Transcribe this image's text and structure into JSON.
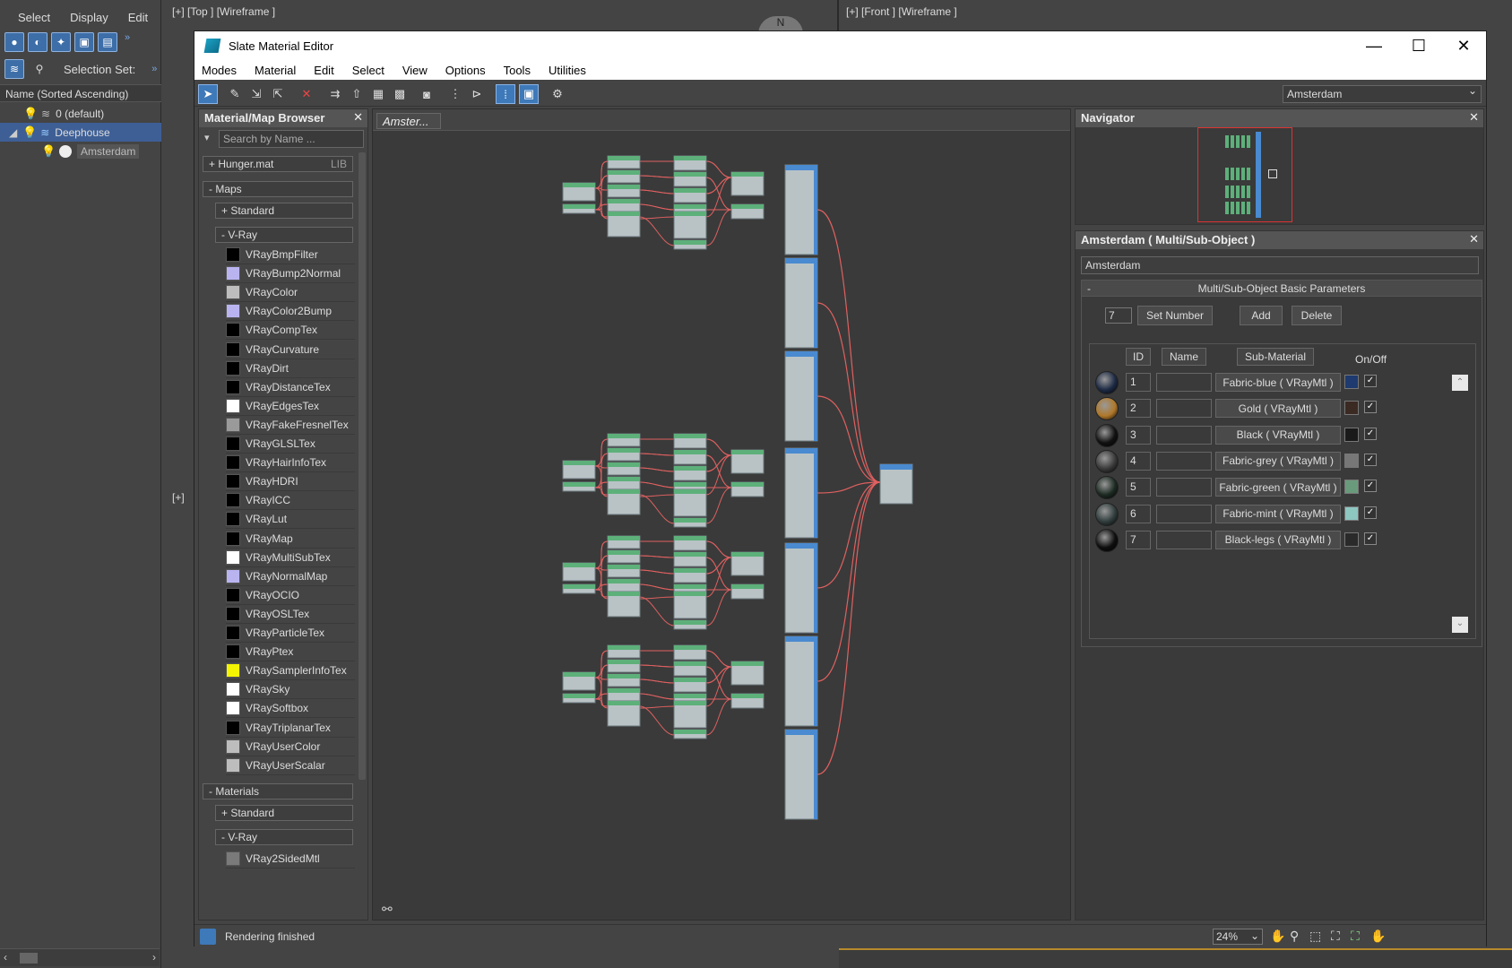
{
  "left_menu": [
    "Select",
    "Display",
    "Edit"
  ],
  "selection_set_label": "Selection Set:",
  "sort_header": "Name (Sorted Ascending)",
  "scene_tree": [
    {
      "label": "0 (default)",
      "selected": false
    },
    {
      "label": "Deephouse",
      "selected": true
    },
    {
      "label": "Amsterdam",
      "selected": false
    }
  ],
  "viewports": {
    "top_label": "[+] [Top ] [Wireframe ]",
    "front_label": "[+] [Front ] [Wireframe ]",
    "bottom_left_label": "[+]",
    "compass_letter": "N"
  },
  "editor": {
    "title": "Slate Material Editor",
    "menu": [
      "Modes",
      "Material",
      "Edit",
      "Select",
      "View",
      "Options",
      "Tools",
      "Utilities"
    ],
    "view_selector": "Amsterdam"
  },
  "browser": {
    "title": "Material/Map Browser",
    "search_placeholder": "Search by Name ...",
    "library": "+ Hunger.mat",
    "library_tag": "LIB",
    "maps_group": "- Maps",
    "standard_group": "+ Standard",
    "vray_group": "- V-Ray",
    "maps": [
      {
        "name": "VRayBmpFilter",
        "color": "#000000"
      },
      {
        "name": "VRayBump2Normal",
        "color": "#b9b4f0"
      },
      {
        "name": "VRayColor",
        "color": "#bdbdbd"
      },
      {
        "name": "VRayColor2Bump",
        "color": "#b9b4f0"
      },
      {
        "name": "VRayCompTex",
        "color": "#000000"
      },
      {
        "name": "VRayCurvature",
        "color": "#000000"
      },
      {
        "name": "VRayDirt",
        "color": "#000000"
      },
      {
        "name": "VRayDistanceTex",
        "color": "#000000"
      },
      {
        "name": "VRayEdgesTex",
        "color": "#ffffff"
      },
      {
        "name": "VRayFakeFresnelTex",
        "color": "#9a9a9a"
      },
      {
        "name": "VRayGLSLTex",
        "color": "#000000"
      },
      {
        "name": "VRayHairInfoTex",
        "color": "#000000"
      },
      {
        "name": "VRayHDRI",
        "color": "#000000"
      },
      {
        "name": "VRayICC",
        "color": "#000000"
      },
      {
        "name": "VRayLut",
        "color": "#000000"
      },
      {
        "name": "VRayMap",
        "color": "#000000"
      },
      {
        "name": "VRayMultiSubTex",
        "color": "#ffffff"
      },
      {
        "name": "VRayNormalMap",
        "color": "#b9b4f0"
      },
      {
        "name": "VRayOCIO",
        "color": "#000000"
      },
      {
        "name": "VRayOSLTex",
        "color": "#000000"
      },
      {
        "name": "VRayParticleTex",
        "color": "#000000"
      },
      {
        "name": "VRayPtex",
        "color": "#000000"
      },
      {
        "name": "VRaySamplerInfoTex",
        "color": "#f4f400"
      },
      {
        "name": "VRaySky",
        "color": "#ffffff"
      },
      {
        "name": "VRaySoftbox",
        "color": "#ffffff"
      },
      {
        "name": "VRayTriplanarTex",
        "color": "#000000"
      },
      {
        "name": "VRayUserColor",
        "color": "#bdbdbd"
      },
      {
        "name": "VRayUserScalar",
        "color": "#bdbdbd"
      }
    ],
    "materials_group": "- Materials",
    "mat_standard_group": "+ Standard",
    "mat_vray_group": "- V-Ray",
    "materials": [
      {
        "name": "VRay2SidedMtl",
        "color": "#7a7a7a"
      }
    ]
  },
  "node_view": {
    "tab_label": "Amster..."
  },
  "navigator": {
    "title": "Navigator"
  },
  "params": {
    "title": "Amsterdam  ( Multi/Sub-Object )",
    "material_name": "Amsterdam",
    "rollout_title": "Multi/Sub-Object Basic Parameters",
    "rollout_toggle": "-",
    "number": "7",
    "set_number": "Set Number",
    "add": "Add",
    "delete": "Delete",
    "headers": {
      "id": "ID",
      "name": "Name",
      "sub_material": "Sub-Material",
      "on_off": "On/Off"
    },
    "rows": [
      {
        "id": "1",
        "sub": "Fabric-blue  ( VRayMtl )",
        "color": "#1e3a6e",
        "sphere": "#1d2a44"
      },
      {
        "id": "2",
        "sub": "Gold  ( VRayMtl )",
        "color": "#3b2a22",
        "sphere": "#b0782a"
      },
      {
        "id": "3",
        "sub": "Black  ( VRayMtl )",
        "color": "#1a1a1a",
        "sphere": "#111111"
      },
      {
        "id": "4",
        "sub": "Fabric-grey  ( VRayMtl )",
        "color": "#777777",
        "sphere": "#3a3a3a"
      },
      {
        "id": "5",
        "sub": "Fabric-green  ( VRayMtl )",
        "color": "#6a9a7c",
        "sphere": "#1c2a22"
      },
      {
        "id": "6",
        "sub": "Fabric-mint  ( VRayMtl )",
        "color": "#8ec6c0",
        "sphere": "#303c3c"
      },
      {
        "id": "7",
        "sub": "Black-legs  ( VRayMtl )",
        "color": "#2a2a2a",
        "sphere": "#0e0e0e"
      }
    ]
  },
  "status": {
    "text": "Rendering finished",
    "zoom": "24%"
  }
}
